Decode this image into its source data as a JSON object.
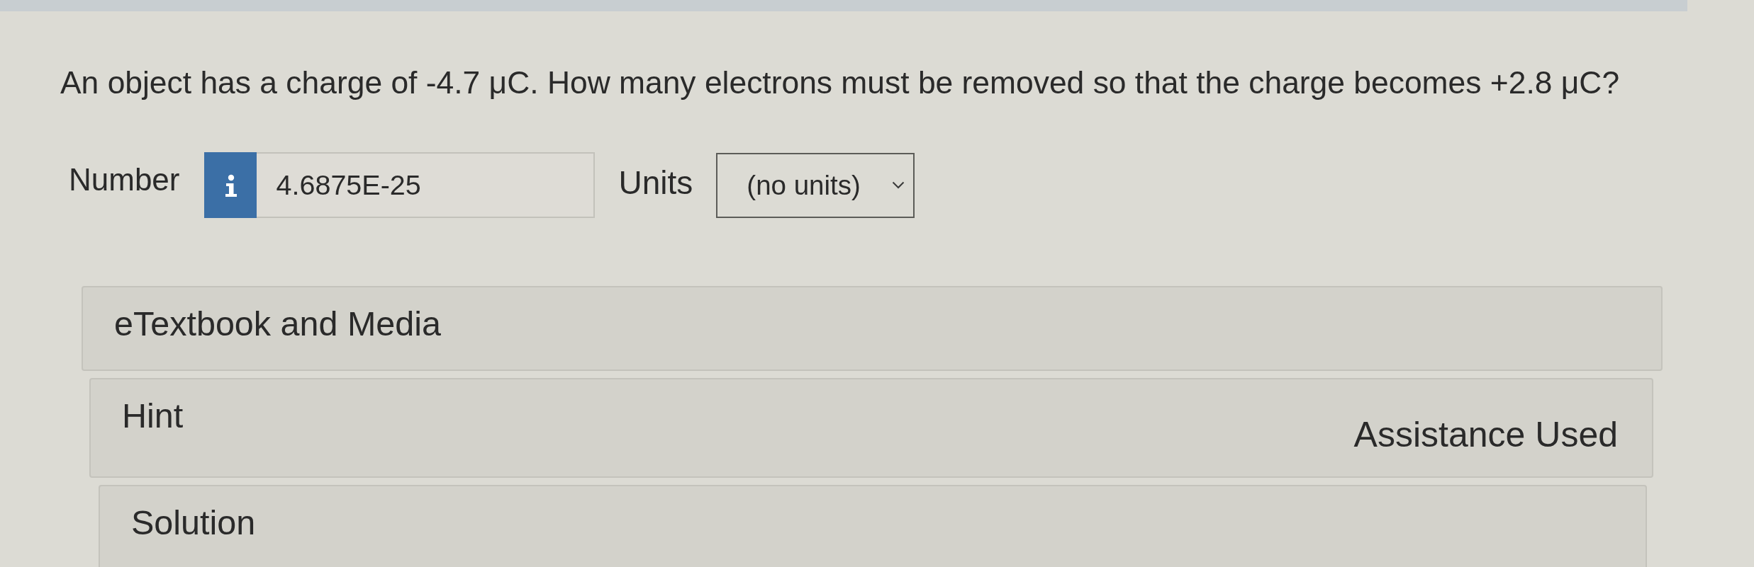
{
  "question": {
    "text": "An object has a charge of -4.7 μC. How many electrons must be removed so that the charge becomes +2.8 μC?"
  },
  "answer": {
    "number_label": "Number",
    "value": "4.6875E-25",
    "units_label": "Units",
    "units_value": "(no units)"
  },
  "panels": [
    {
      "title": "eTextbook and Media"
    },
    {
      "title": "Hint",
      "status": "Assistance Used"
    },
    {
      "title": "Solution"
    }
  ]
}
